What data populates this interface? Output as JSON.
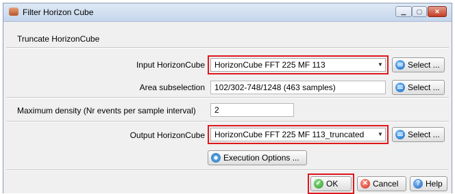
{
  "window": {
    "title": "Filter Horizon Cube",
    "controls": {
      "minimize": "▁",
      "maximize": "▢",
      "close": "✕"
    }
  },
  "section": {
    "title": "Truncate HorizonCube"
  },
  "form": {
    "input_cube": {
      "label": "Input HorizonCube",
      "value": "HorizonCube FFT 225 MF 113"
    },
    "area_subselection": {
      "label": "Area subselection",
      "value": "102/302-748/1248 (463 samples)"
    },
    "max_density": {
      "label": "Maximum density (Nr events per sample interval)",
      "value": "2"
    },
    "output_cube": {
      "label": "Output HorizonCube",
      "value": "HorizonCube FFT 225 MF 113_truncated"
    },
    "select_label": "Select ...",
    "execution_options_label": "Execution Options ..."
  },
  "footer": {
    "ok_label": "OK",
    "cancel_label": "Cancel",
    "help_label": "Help"
  },
  "icons": {
    "app": "horizon-cube-app-icon",
    "select": "list-icon",
    "execution": "gear-icon",
    "ok": "check-icon",
    "cancel": "x-icon",
    "help": "question-icon",
    "dropdown": "chevron-down-icon"
  },
  "colors": {
    "highlight": "#e0161c",
    "titlebar": "#c5d6ec",
    "dialog_bg": "#f0f0f0"
  }
}
